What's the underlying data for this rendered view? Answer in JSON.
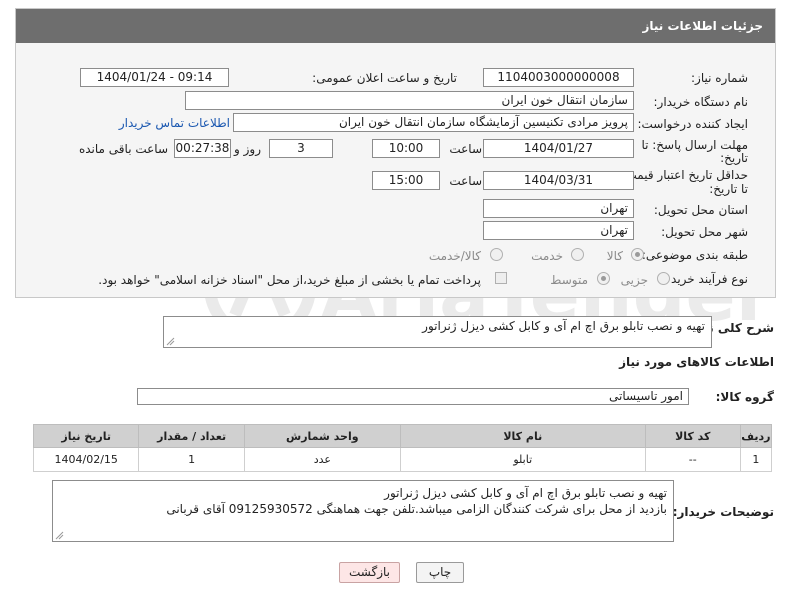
{
  "header": {
    "title": "جزئیات اطلاعات نیاز"
  },
  "fields": {
    "need_number_label": "شماره نیاز:",
    "need_number": "1104003000000008",
    "announce_label": "تاریخ و ساعت اعلان عمومی:",
    "announce_value": "1404/01/24 - 09:14",
    "buyer_org_label": "نام دستگاه خریدار:",
    "buyer_org": "سازمان انتقال خون ایران",
    "creator_label": "ایجاد کننده درخواست:",
    "creator": "پرویز مرادی تکنیسین آزمایشگاه سازمان انتقال خون ایران",
    "contact_link": "اطلاعات تماس خریدار",
    "deadline_label_1": "مهلت ارسال پاسخ: تا",
    "deadline_label_2": "تاریخ:",
    "deadline_date": "1404/01/27",
    "time_label": "ساعت",
    "deadline_time": "10:00",
    "days_value": "3",
    "days_label": "روز و",
    "remaining_time": "00:27:38",
    "remaining_label": "ساعت باقی مانده",
    "price_label_1": "حداقل تاریخ اعتبار قیمت:",
    "price_label_2": "تا تاریخ:",
    "price_date": "1404/03/31",
    "price_time": "15:00",
    "province_label": "استان محل تحویل:",
    "province": "تهران",
    "city_label": "شهر محل تحویل:",
    "city": "تهران",
    "category_label": "طبقه بندی موضوعی:",
    "category_options": [
      "کالا",
      "خدمت",
      "کالا/خدمت"
    ],
    "process_label": "نوع فرآیند خرید :",
    "process_options": [
      "جزیی",
      "متوسط"
    ],
    "payment_note": "پرداخت تمام یا بخشی از مبلغ خرید،از محل \"اسناد خزانه اسلامی\" خواهد بود."
  },
  "description": {
    "label": "شرح کلی نیاز:",
    "text": "تهیه و نصب تابلو برق اچ ام آی و کابل کشی دیزل ژنراتور"
  },
  "goods_section": {
    "title": "اطلاعات کالاهای مورد نیاز",
    "group_label": "گروه کالا:",
    "group_value": "امور تاسیساتی"
  },
  "table": {
    "headers": [
      "ردیف",
      "کد کالا",
      "نام کالا",
      "واحد شمارش",
      "تعداد / مقدار",
      "تاریخ نیاز"
    ],
    "rows": [
      [
        "1",
        "--",
        "تابلو",
        "عدد",
        "1",
        "1404/02/15"
      ]
    ]
  },
  "buyer_notes": {
    "label": "توضیحات خریدار:",
    "line1": "تهیه و نصب تابلو برق اچ ام آی و کابل کشی دیزل ژنراتور",
    "line2": "بازدید از محل برای شرکت کنندگان الزامی میباشد.تلفن جهت هماهنگی 09125930572 آقای قربانی"
  },
  "buttons": {
    "print": "چاپ",
    "back": "بازگشت"
  },
  "watermark": {
    "text": "AriaTender.net"
  }
}
